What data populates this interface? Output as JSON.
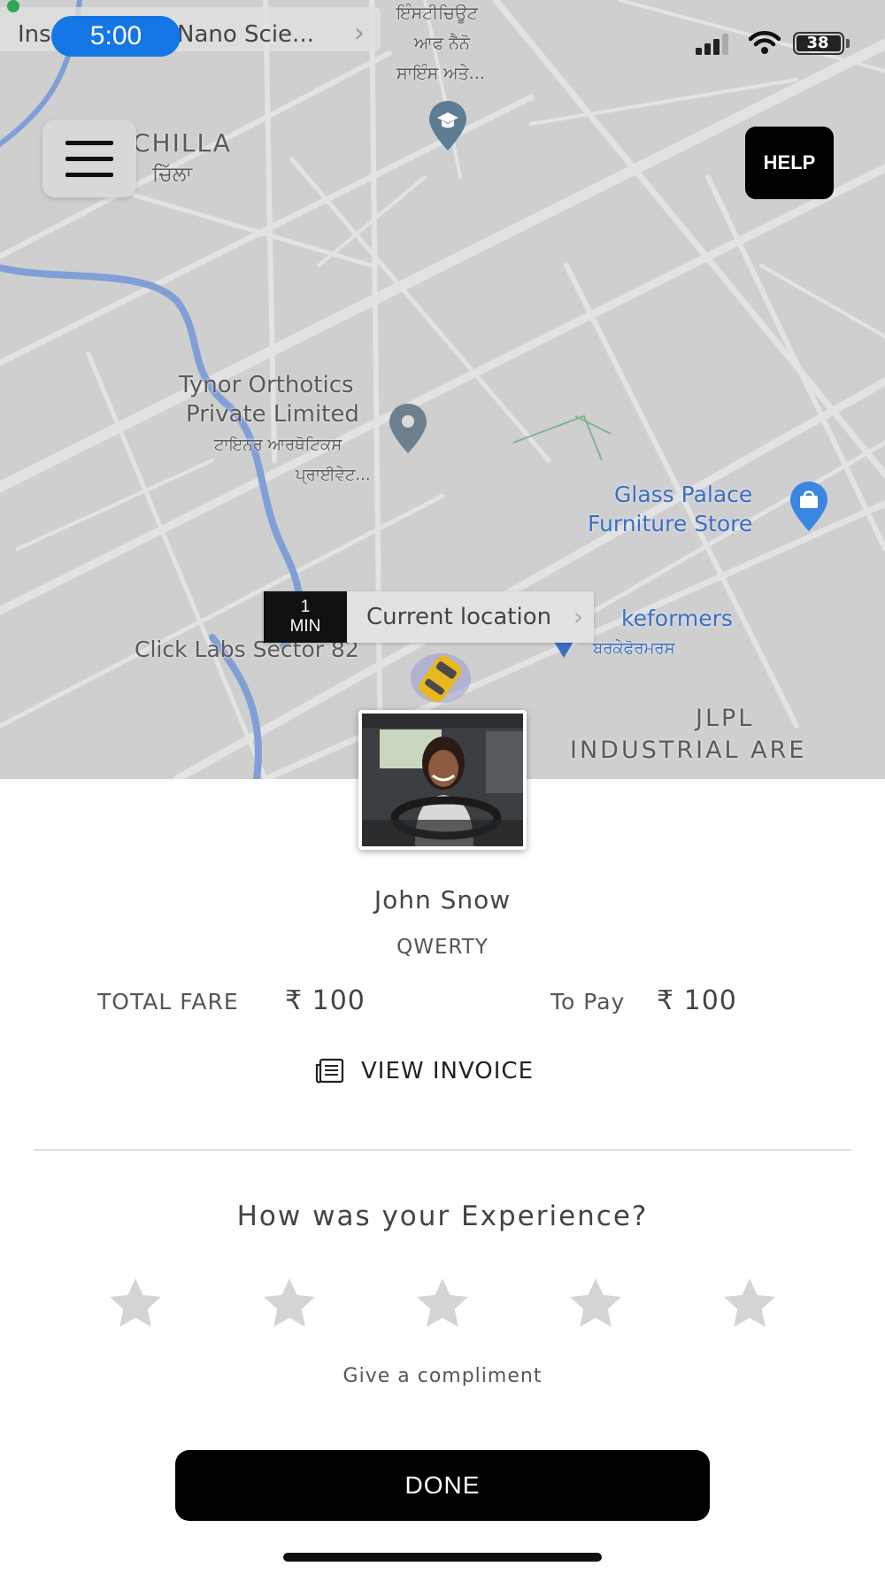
{
  "status_bar": {
    "back_app_left": "Ins",
    "back_app_right": "Nano Scie...",
    "time": "5:00",
    "battery": "38"
  },
  "map": {
    "labels": {
      "inst_punjabi_1": "ਇੰਸਟੀਚਿਊਟ",
      "inst_punjabi_2": "ਆਫ ਨੈਨੋ",
      "inst_punjabi_3": "ਸਾਇੰਸ ਅਤੇ...",
      "chilla": "CHILLA",
      "chilla_punjabi": "ਚਿੱਲਾ",
      "tynor_1": "Tynor Orthotics",
      "tynor_2": "Private Limited",
      "tynor_punjabi_1": "ਟਾਇਨਰ ਆਰਥੋਟਿਕਸ",
      "tynor_punjabi_2": "ਪ੍ਰਾਈਵੇਟ...",
      "glass_1": "Glass Palace",
      "glass_2": "Furniture Store",
      "keformers": "keformers",
      "keformers_punjabi": "ਬਰਕੇਫੋਰਮਰਸ",
      "click_labs": "Click Labs Sector 82",
      "jlpl_1": "JLPL",
      "jlpl_2": "INDUSTRIAL ARE"
    },
    "help_label": "HELP",
    "eta": {
      "number": "1",
      "unit": "MIN",
      "location": "Current location"
    }
  },
  "driver": {
    "name": "John Snow",
    "plate": "QWERTY"
  },
  "fare": {
    "total_label": "TOTAL FARE",
    "total_value": "₹ 100",
    "to_pay_label": "To Pay",
    "to_pay_value": "₹ 100"
  },
  "invoice_label": "VIEW INVOICE",
  "rating": {
    "question": "How was your Experience?",
    "max_stars": 5,
    "selected": 0,
    "compliment": "Give a compliment"
  },
  "done_label": "DONE",
  "colors": {
    "map_bg": "#cfcfcf",
    "road": "#e2e2e2",
    "river": "#7f9fd6",
    "accent_blue": "#1577e6",
    "star_inactive": "#d4d4d4",
    "button_black": "#000000"
  },
  "icons": [
    "signal-icon",
    "wifi-icon",
    "battery-icon",
    "menu-icon",
    "graduation-pin-icon",
    "location-pin-icon",
    "shopping-pin-icon",
    "car-icon",
    "invoice-icon",
    "star-icon"
  ]
}
